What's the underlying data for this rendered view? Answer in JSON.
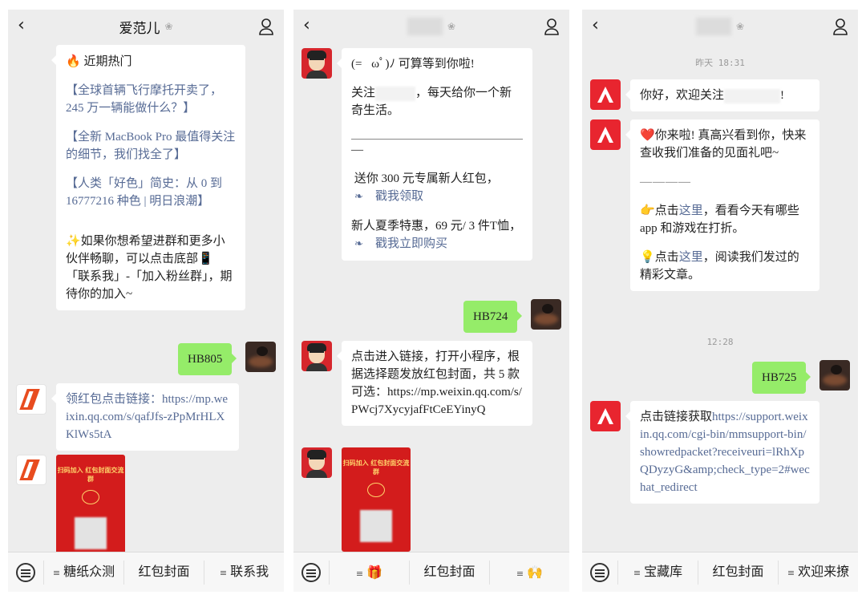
{
  "phones": [
    {
      "title": "爱范儿",
      "messages": {
        "hot_header": "近期热门",
        "hot1": "【全球首辆飞行摩托开卖了，245 万一辆能做什么？】",
        "hot2": "【全新 MacBook Pro 最值得关注的细节，我们找全了】",
        "hot3": "【人类「好色」简史：从 0 到 16777216 种色 | 明日浪潮】",
        "invite": "✨如果你想希望进群和更多小伙伴畅聊，可以点击底部📱「联系我」-「加入粉丝群」，期待你的加入~",
        "reply": "HB805",
        "link_text": "领红包点击链接：https://mp.weixin.qq.com/s/qafJfs-zPpMrHLXKlWs5tA",
        "card_text": "扫码加入 红包封面交流群"
      },
      "menu": [
        "糖纸众测",
        "红包封面",
        "联系我"
      ]
    },
    {
      "title_suffix": "",
      "messages": {
        "greet": "(=ﾟωﾟ)ﾉ 可算等到你啦!",
        "follow_a": "关注",
        "follow_b": "，每天给你一个新奇生活。",
        "dash_tail": "—",
        "gift": "送你 300 元专属新人红包，",
        "gift_link": "戳我领取",
        "summer": "新人夏季特惠，69 元/ 3 件T恤，",
        "summer_link": "戳我立即购买",
        "reply": "HB724",
        "mini": "点击进入链接，打开小程序，根据选择题发放红包封面，共 5 款可选：https://mp.weixin.qq.com/s/PWcj7XycyjafFtCeEYinyQ",
        "card_text": "扫码加入 红包封面交流群"
      },
      "menu": [
        "🎁",
        "红包封面",
        "🙌"
      ]
    },
    {
      "messages": {
        "stamp1": "昨天 18:31",
        "hello_a": "你好，欢迎关注",
        "hello_b": "!",
        "welcome": "❤️你来啦! 真高兴看到你，快来查收我们准备的见面礼吧~",
        "dashes": "————",
        "here1_a": "👉点击",
        "here1_link": "这里",
        "here1_b": "，看看今天有哪些 app 和游戏在打折。",
        "here2_a": "💡点击",
        "here2_link": "这里",
        "here2_b": "，阅读我们发过的精彩文章。",
        "stamp2": "12:28",
        "reply": "HB725",
        "link_a": "点击链接获取",
        "link_url": "https://support.weixin.qq.com/cgi-bin/mmsupport-bin/showredpacket?receiveuri=lRhXpQDyzyG&amp;check_type=2#wechat_redirect"
      },
      "menu": [
        "宝藏库",
        "红包封面",
        "欢迎来撩"
      ]
    }
  ]
}
